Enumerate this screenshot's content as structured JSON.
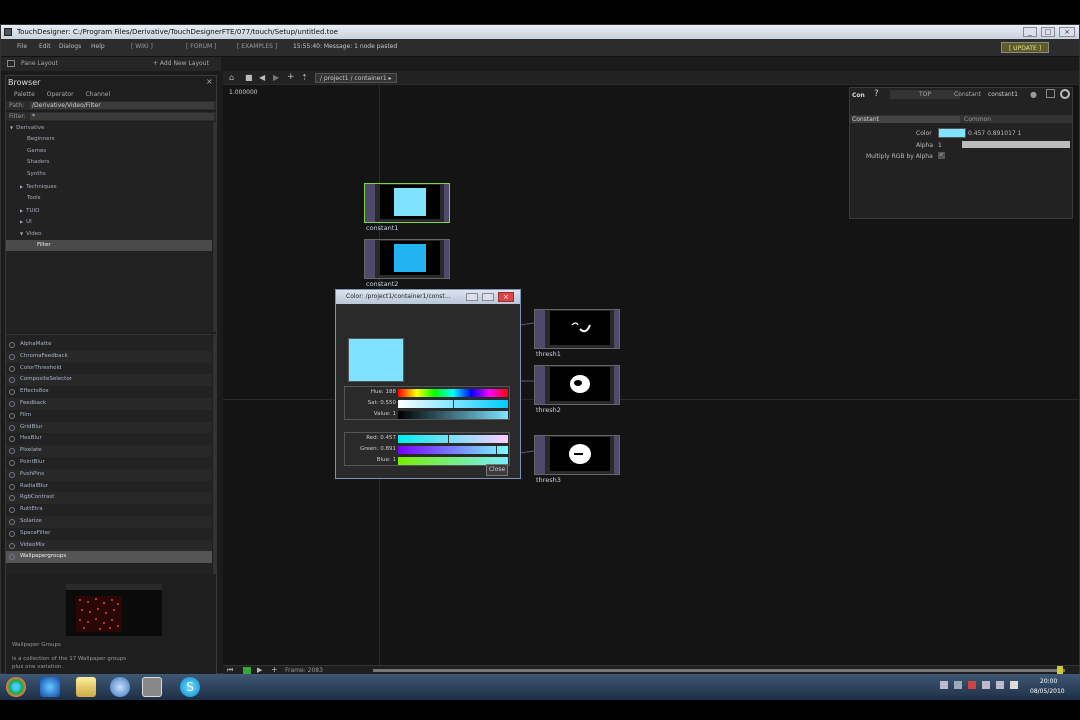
{
  "window": {
    "title": "TouchDesigner: C:/Program Files/Derivative/TouchDesignerFTE/077/touch/Setup/untitled.toe",
    "min_glyph": "_",
    "max_glyph": "□",
    "close_glyph": "×"
  },
  "menubar": {
    "items": [
      "File",
      "Edit",
      "Dialogs",
      "Help"
    ],
    "links": [
      "[ WIKI ]",
      "[ FORUM ]",
      "[ EXAMPLES ]"
    ],
    "message": "15:55:40: Message: 1 node pasted",
    "update": "[ UPDATE ]"
  },
  "layoutbar": {
    "pane_layout": "Pane Layout",
    "add_layout": "+ Add New Layout"
  },
  "browser": {
    "title": "Browser",
    "tabs": [
      "Palette",
      "Operator",
      "Channel"
    ],
    "path_label": "Path:",
    "path_value": "/Derivative/Video/Filter",
    "filter_label": "Filter:",
    "filter_value": "*",
    "tree": [
      {
        "label": "Derivative",
        "indent": 1,
        "arrow": "▼"
      },
      {
        "label": "Beginners",
        "indent": 2
      },
      {
        "label": "Games",
        "indent": 2
      },
      {
        "label": "Shaders",
        "indent": 2
      },
      {
        "label": "Synths",
        "indent": 2
      },
      {
        "label": "Techniques",
        "indent": 2,
        "arrow": "▶"
      },
      {
        "label": "Tools",
        "indent": 2
      },
      {
        "label": "TUIO",
        "indent": 2,
        "arrow": "▶"
      },
      {
        "label": "UI",
        "indent": 2,
        "arrow": "▶"
      },
      {
        "label": "Video",
        "indent": 2,
        "arrow": "▼"
      },
      {
        "label": "Filter",
        "indent": 3,
        "selected": true
      }
    ],
    "list": [
      "AlphaMatte",
      "ChromaFeedback",
      "ColorThreshold",
      "CompositeSelector",
      "Effects8ox",
      "Feedback",
      "Film",
      "GridBlur",
      "HexBlur",
      "Pixelate",
      "PointBlur",
      "PushPins",
      "RadialBlur",
      "RgbContrast",
      "RuttEtra",
      "Solarize",
      "SpaceFilter",
      "VideoMix",
      "Wallpapergroups"
    ],
    "preview_caption": "Wallpaper Groups",
    "preview_desc_1": "is a collection of the 17 Wallpaper groups",
    "preview_desc_2": "plus one variation."
  },
  "network": {
    "path": "/ project1 / container1 ▸",
    "zoom": "1.000000",
    "nodes": [
      "constant1",
      "constant2",
      "thresh1",
      "thresh2",
      "thresh3"
    ]
  },
  "color_dialog": {
    "title": "Color: /project1/container1/const...",
    "hue": "Hue: 188",
    "sat": "Sat: 0.550",
    "value": "Value: 1",
    "red": "Red: 0.457",
    "green": "Green: 0.891",
    "blue": "Blue: 1",
    "close": "Close"
  },
  "params": {
    "short": "Con",
    "help": "?",
    "family": "TOP",
    "op_label": "Constant",
    "op_name": "constant1",
    "page_1": "Constant",
    "page_2": "Common",
    "color_label": "Color",
    "color_values": "0.457    0.891017  1",
    "alpha_label": "Alpha",
    "alpha_value": "1",
    "multiply_label": "Multiply RGB by Alpha",
    "checkmark": "✓",
    "swatch": "#7fe3ff"
  },
  "timeline": {
    "frame": "Frame: 2083"
  },
  "taskbar": {
    "time": "20:00",
    "date": "08/05/2010"
  }
}
